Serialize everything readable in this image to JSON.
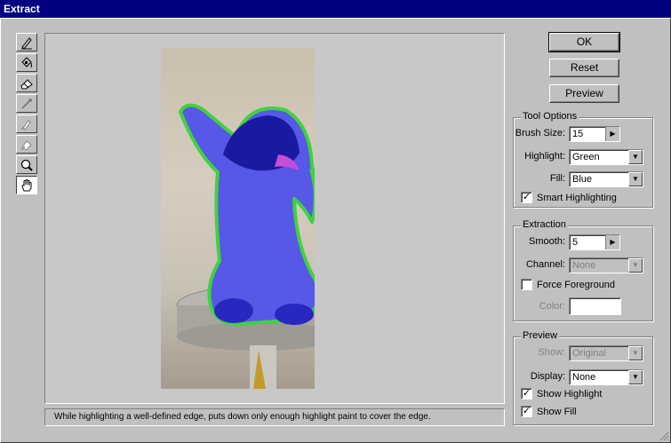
{
  "window": {
    "title": "Extract"
  },
  "tools": [
    {
      "name": "edge-highlighter-tool",
      "icon": "edge-highlighter-icon"
    },
    {
      "name": "fill-tool",
      "icon": "paint-bucket-icon"
    },
    {
      "name": "eraser-tool",
      "icon": "eraser-icon"
    },
    {
      "name": "eyedropper-tool",
      "icon": "eyedropper-icon"
    },
    {
      "name": "cleanup-tool",
      "icon": "cleanup-icon"
    },
    {
      "name": "edge-touchup-tool",
      "icon": "edge-touchup-icon"
    },
    {
      "name": "zoom-tool",
      "icon": "magnifier-icon"
    },
    {
      "name": "hand-tool",
      "icon": "hand-icon"
    }
  ],
  "buttons": {
    "ok": "OK",
    "reset": "Reset",
    "preview": "Preview"
  },
  "tool_options": {
    "title": "Tool Options",
    "brush_size_label": "Brush Size:",
    "brush_size_value": "15",
    "highlight_label": "Highlight:",
    "highlight_value": "Green",
    "fill_label": "Fill:",
    "fill_value": "Blue",
    "smart_highlighting_label": "Smart Highlighting",
    "smart_highlighting_checked": true
  },
  "extraction": {
    "title": "Extraction",
    "smooth_label": "Smooth:",
    "smooth_value": "5",
    "channel_label": "Channel:",
    "channel_value": "None",
    "force_foreground_label": "Force Foreground",
    "force_foreground_checked": false,
    "color_label": "Color:"
  },
  "preview": {
    "title": "Preview",
    "show_label": "Show:",
    "show_value": "Original",
    "display_label": "Display:",
    "display_value": "None",
    "show_highlight_label": "Show Highlight",
    "show_highlight_checked": true,
    "show_fill_label": "Show Fill",
    "show_fill_checked": true
  },
  "status_text": "While highlighting a well-defined edge, puts down only enough highlight paint to cover the edge.",
  "colors": {
    "titlebar": "#000080",
    "highlight": "#3fd23f",
    "fill": "#4b4be0"
  }
}
